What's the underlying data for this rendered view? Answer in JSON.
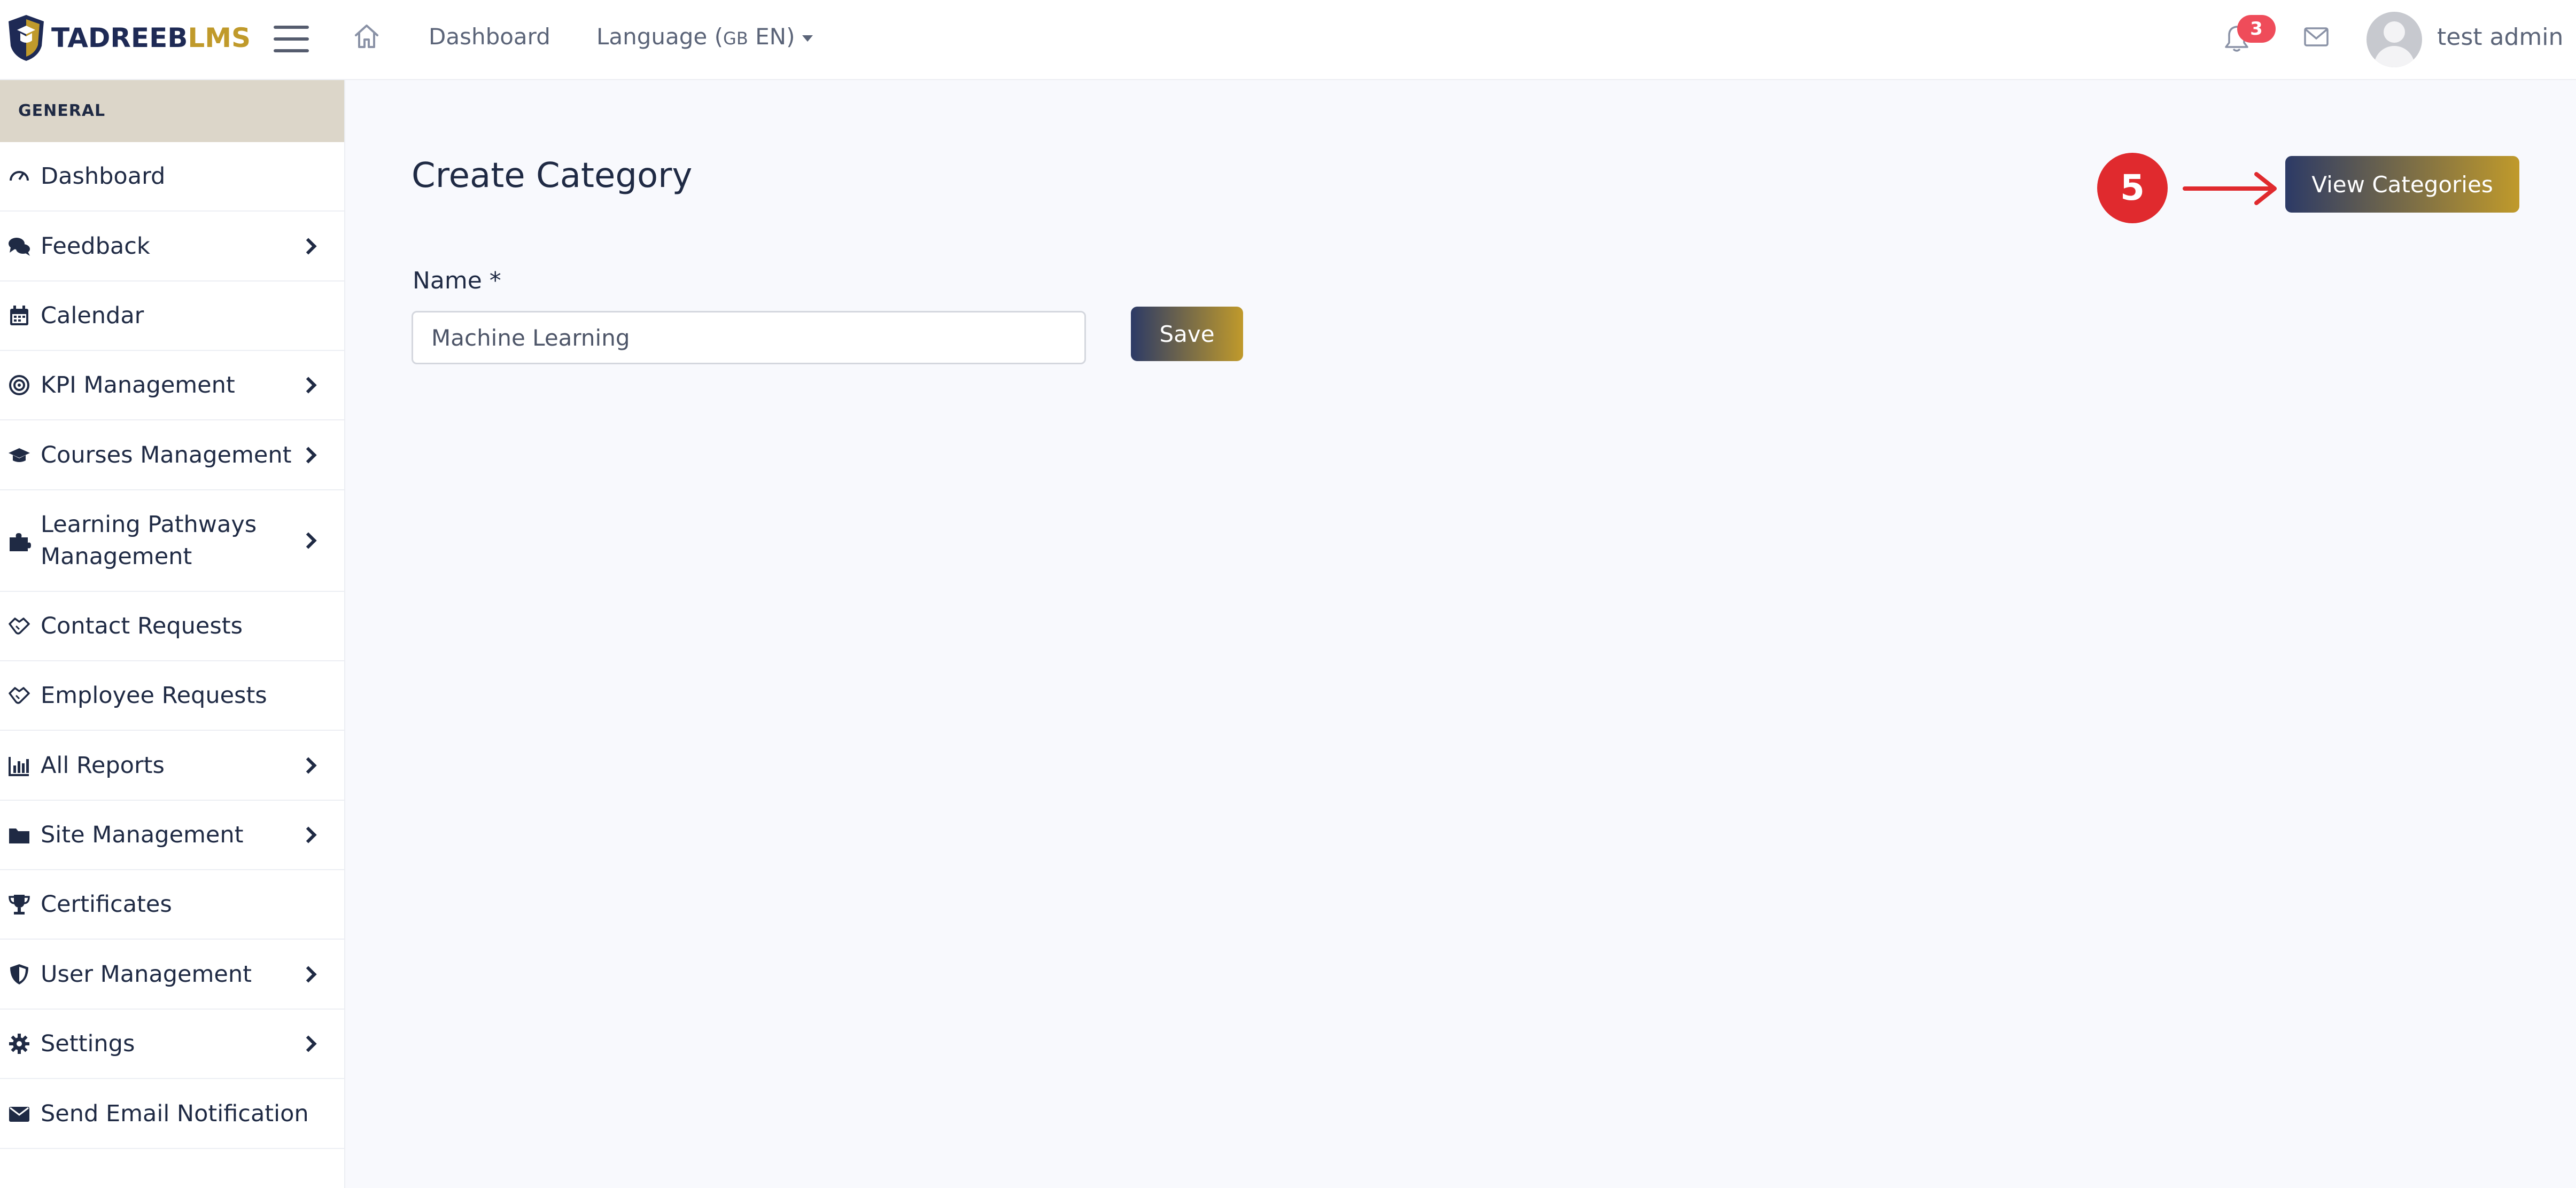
{
  "brand": {
    "part1": "TADREEB",
    "part2": "LMS"
  },
  "topbar": {
    "dashboard_link": "Dashboard",
    "language_label": "Language (",
    "language_flag": "GB",
    "language_code": " EN)",
    "notification_count": "3",
    "user_name": "test admin"
  },
  "sidebar": {
    "section_header": "GENERAL",
    "items": [
      {
        "label": "Dashboard",
        "icon": "dashboard-gauge-icon",
        "has_submenu": false
      },
      {
        "label": "Feedback",
        "icon": "comments-icon",
        "has_submenu": true
      },
      {
        "label": "Calendar",
        "icon": "calendar-icon",
        "has_submenu": false
      },
      {
        "label": "KPI Management",
        "icon": "target-icon",
        "has_submenu": true
      },
      {
        "label": "Courses Management",
        "icon": "graduation-cap-icon",
        "has_submenu": true
      },
      {
        "label": "Learning Pathways Management",
        "icon": "puzzle-icon",
        "has_submenu": true
      },
      {
        "label": "Contact Requests",
        "icon": "handshake-icon",
        "has_submenu": false
      },
      {
        "label": "Employee Requests",
        "icon": "handshake-icon",
        "has_submenu": false
      },
      {
        "label": "All Reports",
        "icon": "bar-chart-icon",
        "has_submenu": true
      },
      {
        "label": "Site Management",
        "icon": "folder-icon",
        "has_submenu": true
      },
      {
        "label": "Certificates",
        "icon": "trophy-icon",
        "has_submenu": false
      },
      {
        "label": "User Management",
        "icon": "shield-icon",
        "has_submenu": true
      },
      {
        "label": "Settings",
        "icon": "gear-icon",
        "has_submenu": true
      },
      {
        "label": "Send Email Notification",
        "icon": "envelope-icon",
        "has_submenu": false
      }
    ]
  },
  "main": {
    "title": "Create Category",
    "name_label": "Name *",
    "name_value": "Machine Learning",
    "save_label": "Save",
    "view_categories_label": "View Categories",
    "step_number": "5"
  },
  "colors": {
    "accent_navy": "#2c3a66",
    "accent_gold": "#c09a2b",
    "badge_red": "#ef4c5a",
    "step_red": "#e02a2e"
  }
}
